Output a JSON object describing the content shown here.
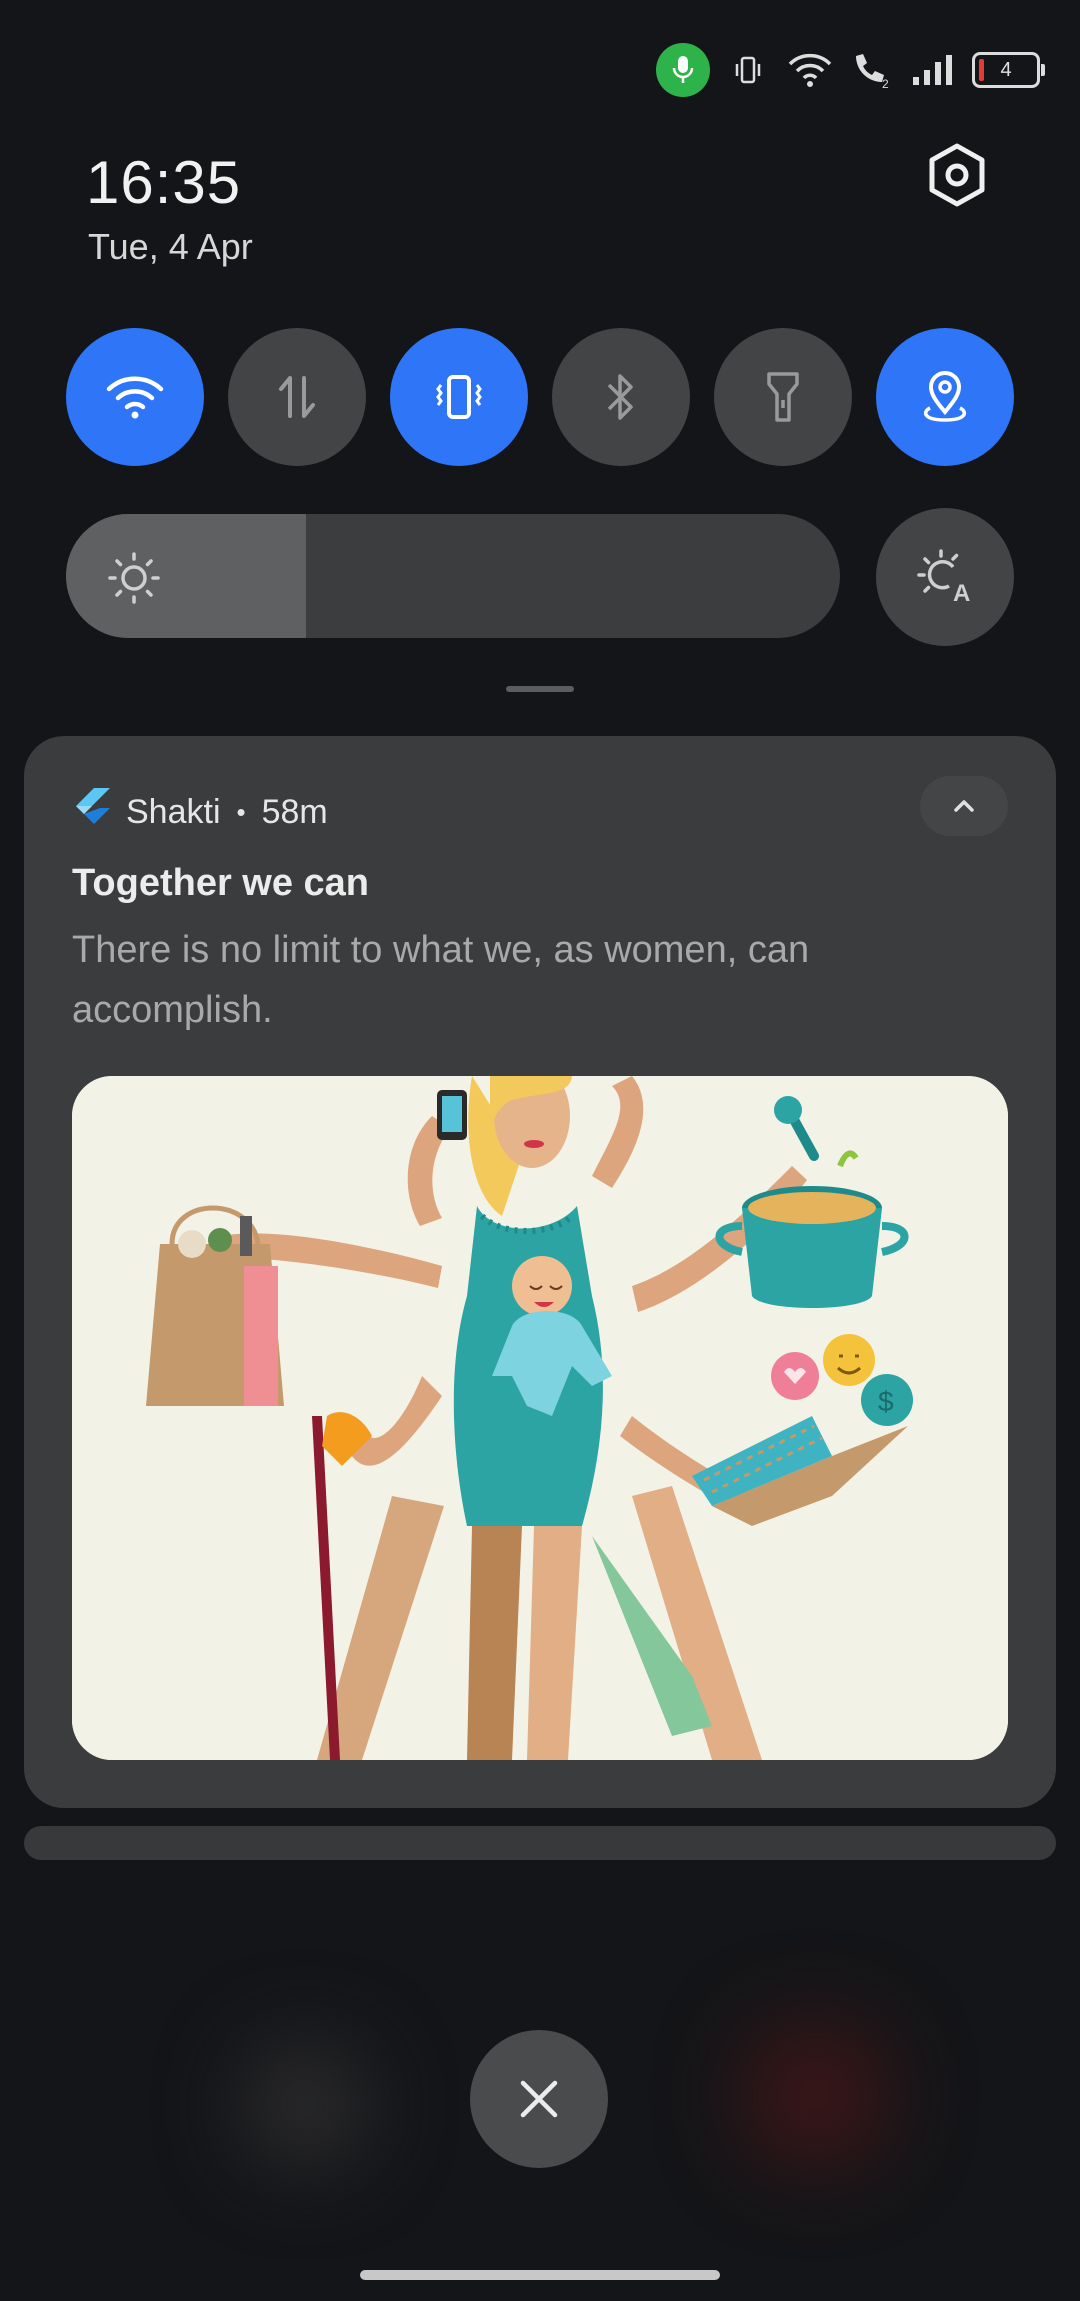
{
  "status_bar": {
    "icons": [
      "mic-active-icon",
      "vibrate-icon",
      "wifi-icon",
      "wifi-calling-icon",
      "signal-icon"
    ],
    "battery_level": "4",
    "colors": {
      "mic": "#2db34a",
      "battery_low": "#e33a3a"
    }
  },
  "header": {
    "time": "16:35",
    "date": "Tue, 4 Apr"
  },
  "quick_tiles": [
    {
      "name": "wifi",
      "state": "on"
    },
    {
      "name": "mobile-data",
      "state": "off"
    },
    {
      "name": "vibrate",
      "state": "on"
    },
    {
      "name": "bluetooth",
      "state": "off"
    },
    {
      "name": "flashlight",
      "state": "off"
    },
    {
      "name": "location",
      "state": "on"
    }
  ],
  "brightness": {
    "level": 0.31,
    "auto_icon": "auto-brightness-icon"
  },
  "notification": {
    "app_name": "Shakti",
    "separator": "•",
    "time_ago": "58m",
    "title": "Together we can",
    "body": "There is no limit to what we, as women, can accomplish."
  },
  "accent": "#2e76f7"
}
